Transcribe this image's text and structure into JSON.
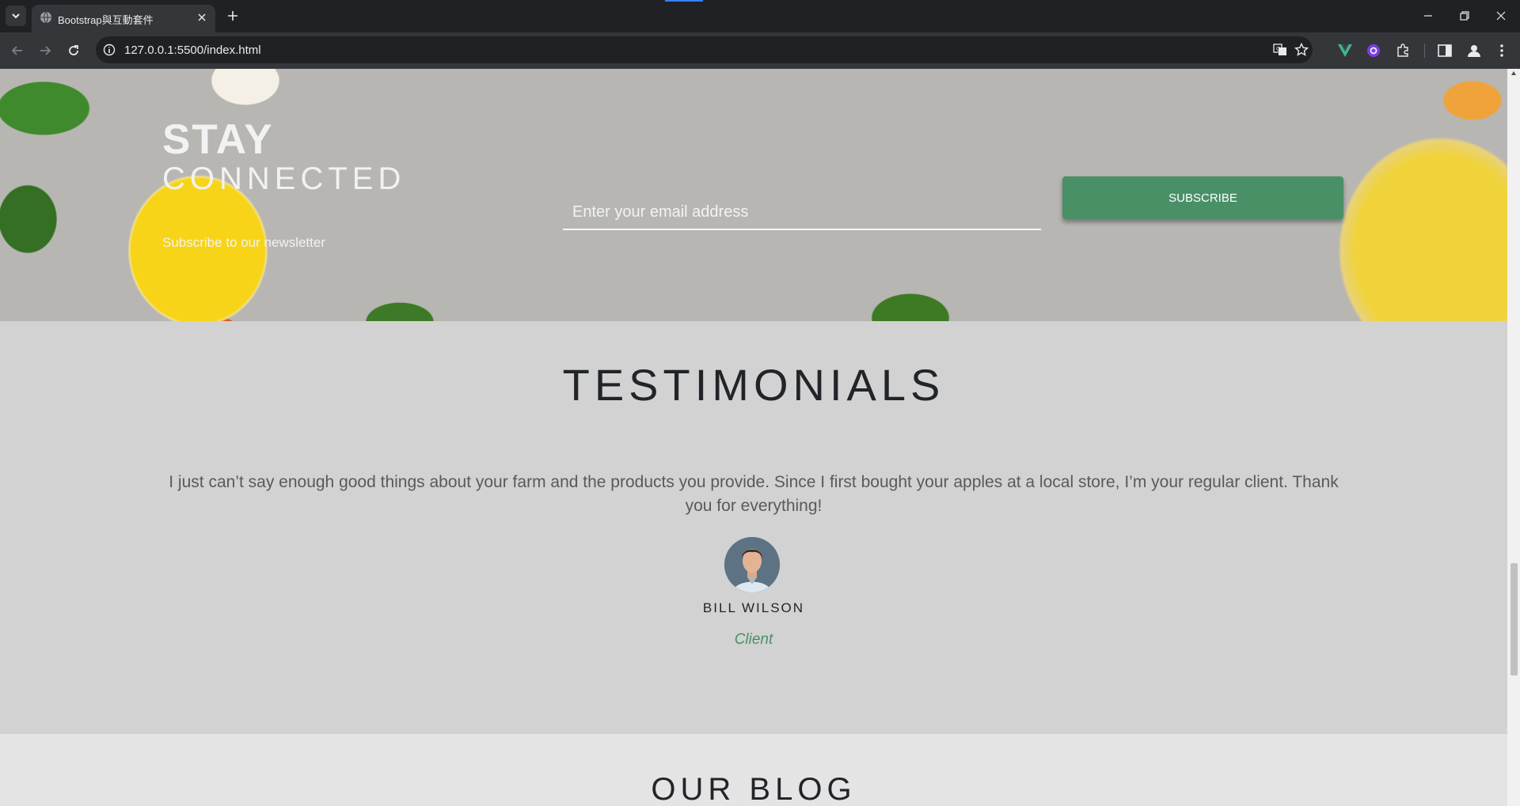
{
  "browser": {
    "tab_title": "Bootstrap與互動套件",
    "url": "127.0.0.1:5500/index.html"
  },
  "newsletter": {
    "title_line1": "STAY",
    "title_line2": "CONNECTED",
    "subtitle": "Subscribe to our newsletter",
    "email_placeholder": "Enter your email address",
    "subscribe_label": "SUBSCRIBE"
  },
  "testimonials": {
    "heading": "TESTIMONIALS",
    "quote": "I just can’t say enough good things about your farm and the products you provide. Since I first bought your apples at a local store, I’m your regular client. Thank you for everything!",
    "name": "BILL WILSON",
    "role": "Client"
  },
  "blog": {
    "heading": "OUR BLOG"
  },
  "colors": {
    "accent_green": "#4a9067",
    "chrome_dark": "#202124",
    "chrome_toolbar": "#35363a"
  },
  "icons": [
    "tab-list-icon",
    "globe-favicon-icon",
    "close-icon",
    "plus-icon",
    "minimize-icon",
    "restore-icon",
    "window-close-icon",
    "back-icon",
    "forward-icon",
    "reload-icon",
    "info-icon",
    "translate-icon",
    "star-icon",
    "vue-extension-icon",
    "extension-purple-icon",
    "puzzle-icon",
    "sidepanel-icon",
    "profile-icon",
    "menu-icon"
  ]
}
